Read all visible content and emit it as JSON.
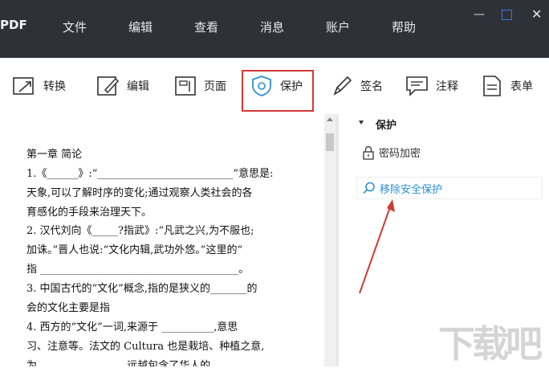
{
  "app": {
    "name": "PDF"
  },
  "menu": [
    "文件",
    "编辑",
    "查看",
    "消息",
    "账户",
    "帮助"
  ],
  "toolbar": {
    "convert": "转换",
    "edit": "编辑",
    "page": "页面",
    "protect": "保护",
    "sign": "签名",
    "comment": "注释",
    "form": "表单"
  },
  "document": {
    "lines": [
      "第一章 简论",
      "1.《______》:“__________________________”意思是:",
      "天象,可以了解时序的变化;通过观察人类社会的各",
      "育感化的手段来治理天下。",
      "2. 汉代刘向《_____?指武》:“凡武之兴,为不服也;",
      "加诛。”晋人也说:“文化内辑,武功外悠。”这里的“",
      "指 ______________________________________。",
      "3. 中国古代的“文化”概念,指的是狭义的_______的",
      "会的文化主要是指",
      "4. 西方的“文化”一词,来源于 __________,意思",
      "习、注意等。法文的 Cultura 也是栽培、种植之意,",
      "为 ________________ 远越包含了华人的"
    ]
  },
  "panel": {
    "title": "保护",
    "password": "密码加密",
    "remove": "移除安全保护"
  },
  "colors": {
    "titlebar": "#2e3138",
    "highlight_frame": "#d23a32",
    "link": "#2a8fd4"
  }
}
